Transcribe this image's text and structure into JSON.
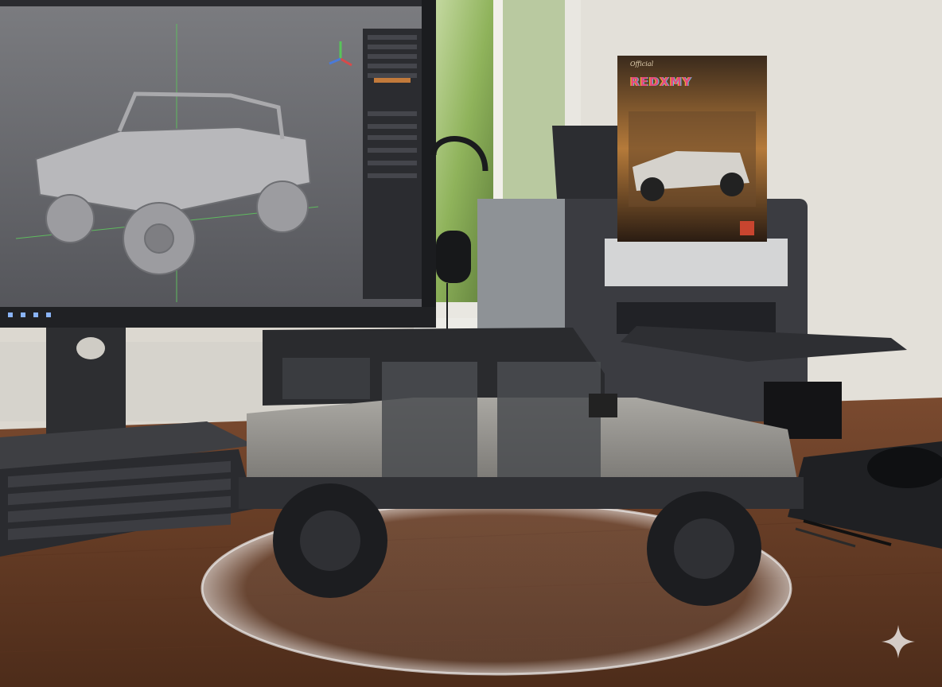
{
  "scene": {
    "description_tag": "photo",
    "objects": [
      "monitor",
      "3d-model-viewport",
      "headphones",
      "printer",
      "poster",
      "scale-model-car",
      "acrylic-turntable",
      "keyboard",
      "mouse",
      "mouse-pad",
      "pens",
      "desk",
      "window"
    ]
  },
  "poster": {
    "title": "REDXMY",
    "signature": "Official"
  },
  "icons": {
    "sparkle": "sparkle-icon"
  },
  "colors": {
    "desk": "#6b4029",
    "wall": "#dcd8d0",
    "window_glass": "#a7c47e",
    "car_body": "#8d8b86",
    "car_roof": "#2a2b2e",
    "viewport_bg": "#6a6b70",
    "printer": "#3a3b3f"
  }
}
